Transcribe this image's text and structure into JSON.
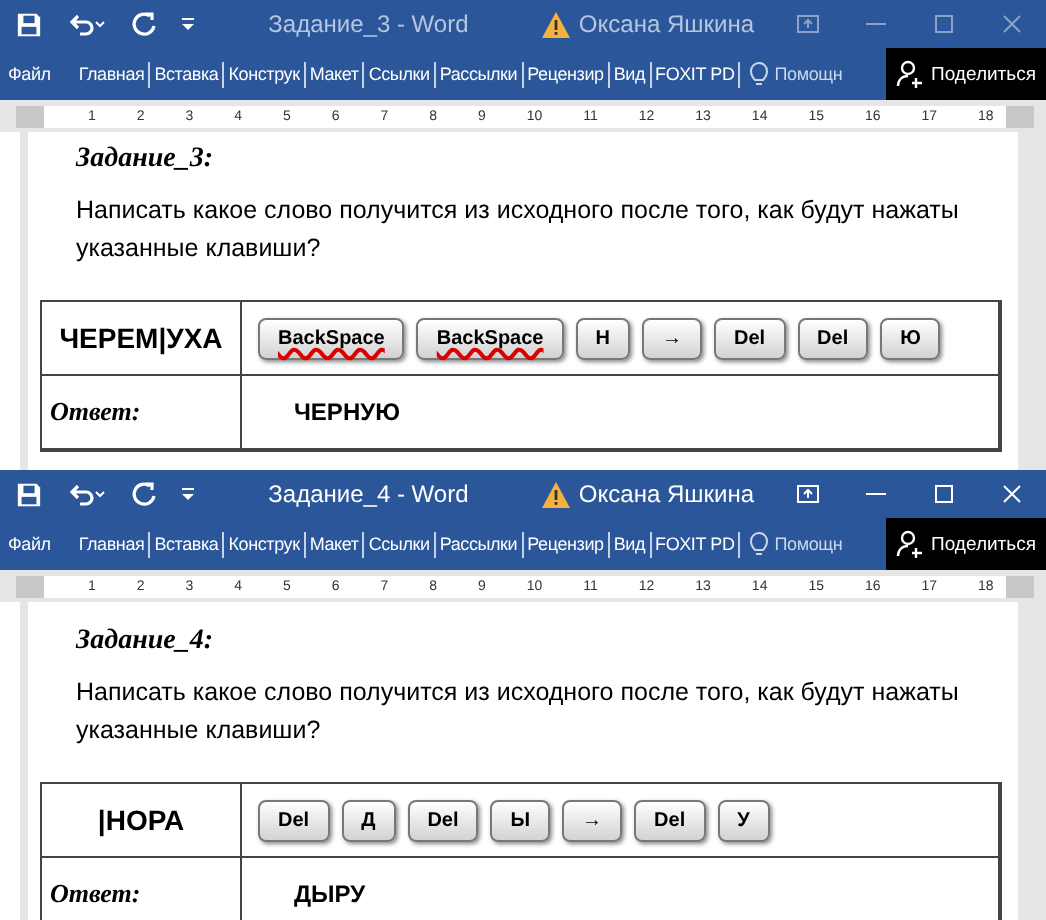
{
  "windows": [
    {
      "title": "Задание_3  -  Word",
      "active": false,
      "user": "Оксана Яшкина",
      "tabs": [
        {
          "label": "Файл"
        },
        {
          "label": "Главная"
        },
        {
          "label": "Вставка"
        },
        {
          "label": "Конструк"
        },
        {
          "label": "Макет"
        },
        {
          "label": "Ссылки"
        },
        {
          "label": "Рассылки"
        },
        {
          "label": "Рецензир"
        },
        {
          "label": "Вид"
        },
        {
          "label": "FOXIT PD"
        }
      ],
      "help": "Помощн",
      "share": "Поделиться",
      "ruler": [
        "1",
        "2",
        "3",
        "4",
        "5",
        "6",
        "7",
        "8",
        "9",
        "10",
        "11",
        "12",
        "13",
        "14",
        "15",
        "16",
        "17",
        "18"
      ],
      "heading": "Задание_3:",
      "question": "Написать какое слово получится из исходного после того, как будут нажаты указанные клавиши?",
      "word": "ЧЕРЕМ|УХА",
      "keys": [
        {
          "label": "BackSpace",
          "misspelled": true
        },
        {
          "label": "BackSpace",
          "misspelled": true
        },
        {
          "label": "Н",
          "misspelled": false
        },
        {
          "label": "→",
          "misspelled": false
        },
        {
          "label": "Del",
          "misspelled": false
        },
        {
          "label": "Del",
          "misspelled": false
        },
        {
          "label": "Ю",
          "misspelled": false
        }
      ],
      "answer_label": "Ответ:",
      "answer": "ЧЕРНУЮ"
    },
    {
      "title": "Задание_4  -  Word",
      "active": true,
      "user": "Оксана Яшкина",
      "tabs": [
        {
          "label": "Файл"
        },
        {
          "label": "Главная"
        },
        {
          "label": "Вставка"
        },
        {
          "label": "Конструк"
        },
        {
          "label": "Макет"
        },
        {
          "label": "Ссылки"
        },
        {
          "label": "Рассылки"
        },
        {
          "label": "Рецензир"
        },
        {
          "label": "Вид"
        },
        {
          "label": "FOXIT PD"
        }
      ],
      "help": "Помощн",
      "share": "Поделиться",
      "ruler": [
        "1",
        "2",
        "3",
        "4",
        "5",
        "6",
        "7",
        "8",
        "9",
        "10",
        "11",
        "12",
        "13",
        "14",
        "15",
        "16",
        "17",
        "18"
      ],
      "heading": "Задание_4:",
      "question": "Написать какое слово получится из исходного после того, как будут нажаты указанные клавиши?",
      "word": "|НОРА",
      "keys": [
        {
          "label": "Del",
          "misspelled": false
        },
        {
          "label": "Д",
          "misspelled": false
        },
        {
          "label": "Del",
          "misspelled": false
        },
        {
          "label": "Ы",
          "misspelled": false
        },
        {
          "label": "→",
          "misspelled": false
        },
        {
          "label": "Del",
          "misspelled": false
        },
        {
          "label": "У",
          "misspelled": false
        }
      ],
      "answer_label": "Ответ:",
      "answer": "ДЫРУ"
    }
  ]
}
